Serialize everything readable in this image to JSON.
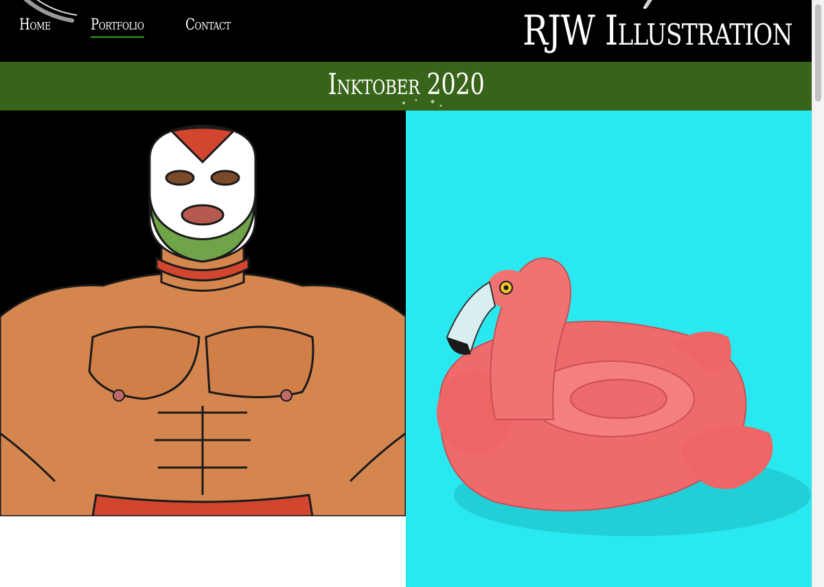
{
  "nav": {
    "items": [
      {
        "label": "Home",
        "active": false
      },
      {
        "label": "Portfolio",
        "active": true
      },
      {
        "label": "Contact",
        "active": false
      }
    ]
  },
  "site": {
    "title": "RJW Illustration"
  },
  "page": {
    "title": "Inktober 2020"
  },
  "gallery": {
    "items": [
      {
        "subject": "masked wrestler illustration"
      },
      {
        "subject": "flamingo pool float illustration"
      }
    ]
  },
  "colors": {
    "header_bg": "#000000",
    "banner_bg": "#376418",
    "active_underline": "#2fa31a",
    "flamingo_bg": "#29e8ef"
  }
}
